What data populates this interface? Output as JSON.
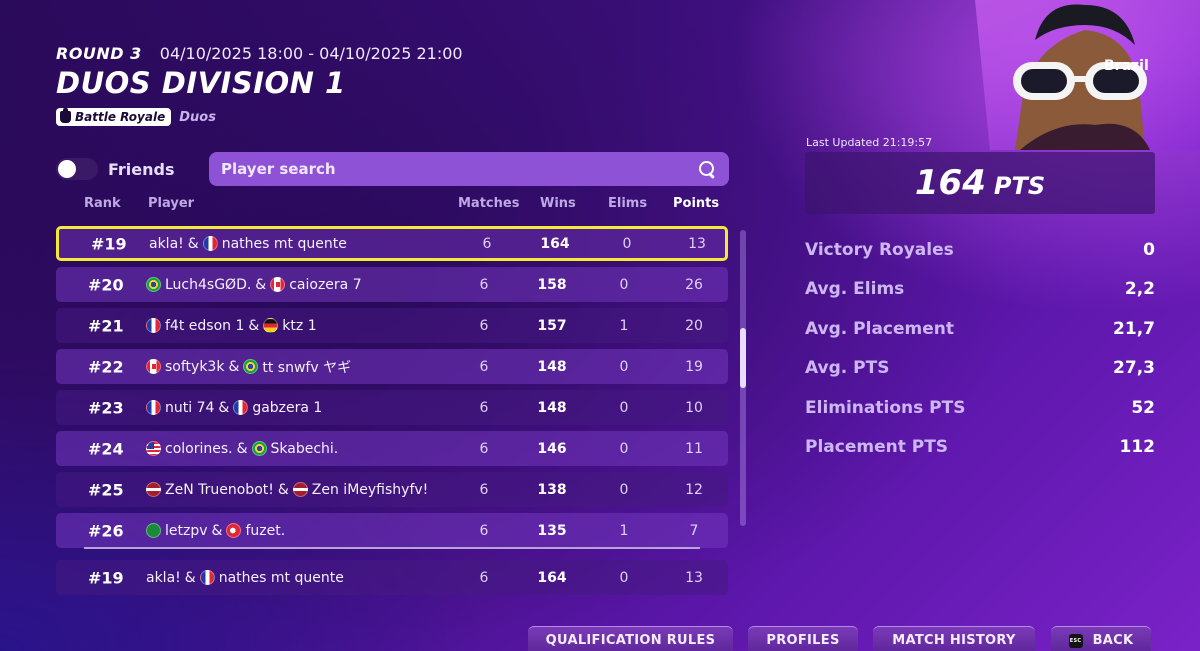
{
  "header": {
    "round_label": "ROUND 3",
    "dates": "04/10/2025 18:00 - 04/10/2025 21:00",
    "division": "DUOS DIVISION 1",
    "mode_badge": "Battle Royale",
    "mode_sub": "Duos"
  },
  "filters": {
    "friends_label": "Friends",
    "search_placeholder": "Player search"
  },
  "columns": {
    "rank": "Rank",
    "player": "Player",
    "matches": "Matches",
    "wins": "Wins",
    "elims": "Elims",
    "points": "Points"
  },
  "rows": [
    {
      "rank": "#19",
      "p1": "akla!",
      "f1": "",
      "p2": "nathes mt quente",
      "f2": "fr",
      "matches": "6",
      "wins": "164",
      "elims": "0",
      "points": "13"
    },
    {
      "rank": "#20",
      "p1": "Luch4sGØD.",
      "f1": "br",
      "p2": "caiozera 7",
      "f2": "ca",
      "matches": "6",
      "wins": "158",
      "elims": "0",
      "points": "26"
    },
    {
      "rank": "#21",
      "p1": "f4t edson 1",
      "f1": "fr",
      "p2": "ktz 1",
      "f2": "de",
      "matches": "6",
      "wins": "157",
      "elims": "1",
      "points": "20"
    },
    {
      "rank": "#22",
      "p1": "softyk3k",
      "f1": "ca",
      "p2": "tt snwfv ヤギ",
      "f2": "br",
      "matches": "6",
      "wins": "148",
      "elims": "0",
      "points": "19"
    },
    {
      "rank": "#23",
      "p1": "nuti 74",
      "f1": "fr",
      "p2": "gabzera 1",
      "f2": "fr",
      "matches": "6",
      "wins": "148",
      "elims": "0",
      "points": "10"
    },
    {
      "rank": "#24",
      "p1": "colorines.",
      "f1": "us",
      "p2": "Skabechi.",
      "f2": "br",
      "matches": "6",
      "wins": "146",
      "elims": "0",
      "points": "11"
    },
    {
      "rank": "#25",
      "p1": "ZeN Truenobot!",
      "f1": "lv",
      "p2": "Zen iMeyfishyfv!",
      "f2": "lv",
      "matches": "6",
      "wins": "138",
      "elims": "0",
      "points": "12"
    },
    {
      "rank": "#26",
      "p1": "letzpv",
      "f1": "sa",
      "p2": "fuzet.",
      "f2": "tr",
      "matches": "6",
      "wins": "135",
      "elims": "1",
      "points": "7"
    }
  ],
  "self_row": {
    "rank": "#19",
    "p1": "akla!",
    "p2": "nathes mt quente",
    "matches": "6",
    "wins": "164",
    "elims": "0",
    "points": "13"
  },
  "profile": {
    "country": "Brazil",
    "last_updated": "Last Updated 21:19:57",
    "total_points": "164",
    "total_unit": "PTS",
    "stats": [
      {
        "label": "Victory Royales",
        "value": "0"
      },
      {
        "label": "Avg. Elims",
        "value": "2,2"
      },
      {
        "label": "Avg. Placement",
        "value": "21,7"
      },
      {
        "label": "Avg. PTS",
        "value": "27,3"
      },
      {
        "label": "Eliminations PTS",
        "value": "52"
      },
      {
        "label": "Placement PTS",
        "value": "112"
      }
    ]
  },
  "buttons": {
    "qualification_rules": "QUALIFICATION RULES",
    "profiles": "PROFILES",
    "match_history": "MATCH HISTORY",
    "back": "BACK",
    "esc_key": "ESC"
  },
  "colors": {
    "highlight": "#f5ea3a",
    "search_bg": "#8e52d6",
    "stat_label": "#cdb7f3"
  }
}
